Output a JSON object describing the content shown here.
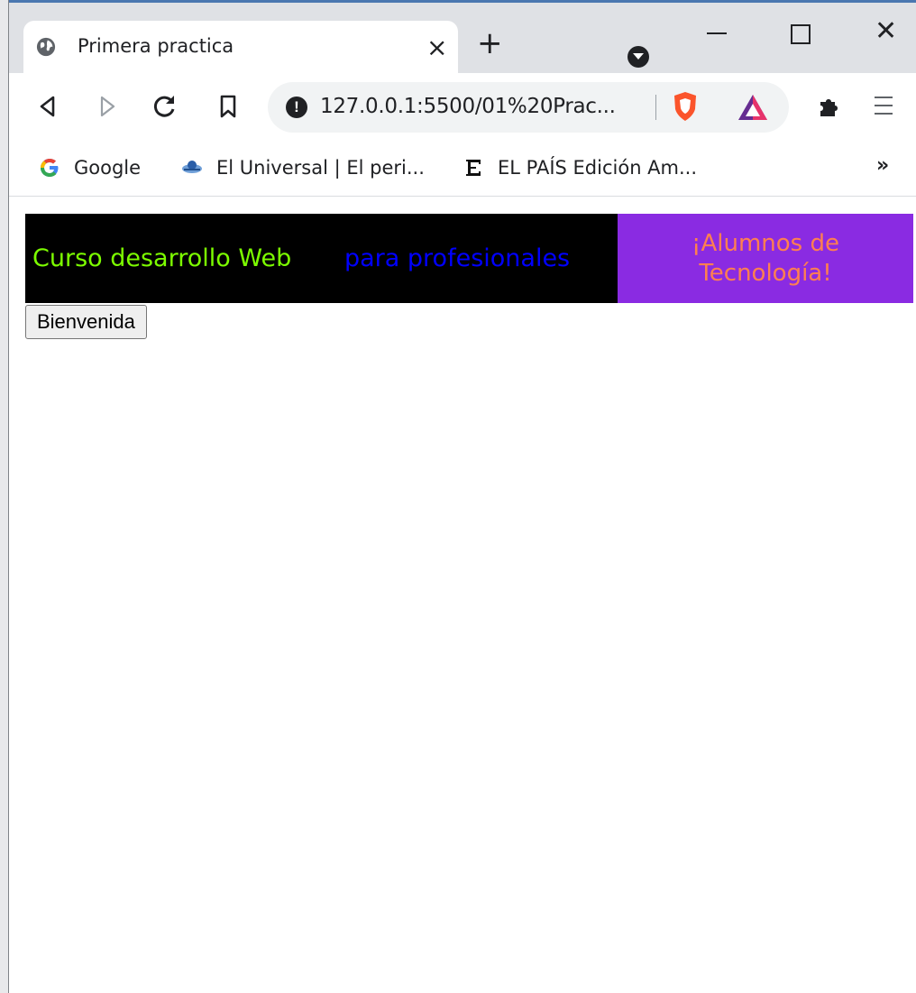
{
  "browser": {
    "tab": {
      "title": "Primera practica",
      "favicon": "globe-icon",
      "close_glyph": "×"
    },
    "new_tab_glyph": "+",
    "window_close_glyph": "✕",
    "address_bar": {
      "url": "127.0.0.1:5500/01%20Prac...",
      "info_glyph": "!"
    },
    "bookmarks": [
      {
        "label": "Google",
        "icon": "google-icon"
      },
      {
        "label": "El Universal | El peri...",
        "icon": "el-universal-icon"
      },
      {
        "label": "EL PAÍS Edición Am...",
        "icon": "el-pais-icon"
      }
    ],
    "bookmarks_overflow": "»"
  },
  "page": {
    "banner": {
      "title": "Curso desarrollo Web",
      "subtitle": "para profesionales",
      "highlight": "¡Alumnos de Tecnología!"
    },
    "welcome_button": "Bienvenida"
  },
  "colors": {
    "banner_bg": "#000000",
    "banner_title": "#7cfc00",
    "banner_subtitle": "#0000ff",
    "highlight_bg": "#8a2be2",
    "highlight_text": "#ff7f50"
  }
}
